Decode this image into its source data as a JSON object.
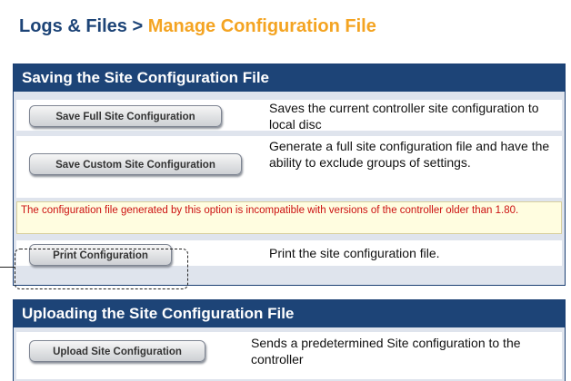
{
  "page": {
    "breadcrumb_parent": "Logs & Files >",
    "breadcrumb_current": "Manage Configuration File"
  },
  "saving": {
    "header": "Saving the Site Configuration File",
    "rows": [
      {
        "button": "Save Full Site Configuration",
        "description": "Saves the current controller site configuration to local disc"
      },
      {
        "button": "Save Custom Site Configuration",
        "description": "Generate a full site configuration file and have the ability to exclude groups of settings."
      },
      {
        "button": "Print Configuration",
        "description": "Print the site configuration file."
      }
    ],
    "warning": "The configuration file generated by this option is incompatible with versions of the controller older than 1.80."
  },
  "uploading": {
    "header": "Uploading the Site Configuration File",
    "rows": [
      {
        "button": "Upload Site Configuration",
        "description": "Sends a predetermined Site configuration to the controller"
      }
    ]
  },
  "colors": {
    "header_bg": "#1d4477",
    "breadcrumb_current": "#f4a422",
    "warning_text": "#cc1111",
    "panel_bg": "#dfe4ed"
  }
}
